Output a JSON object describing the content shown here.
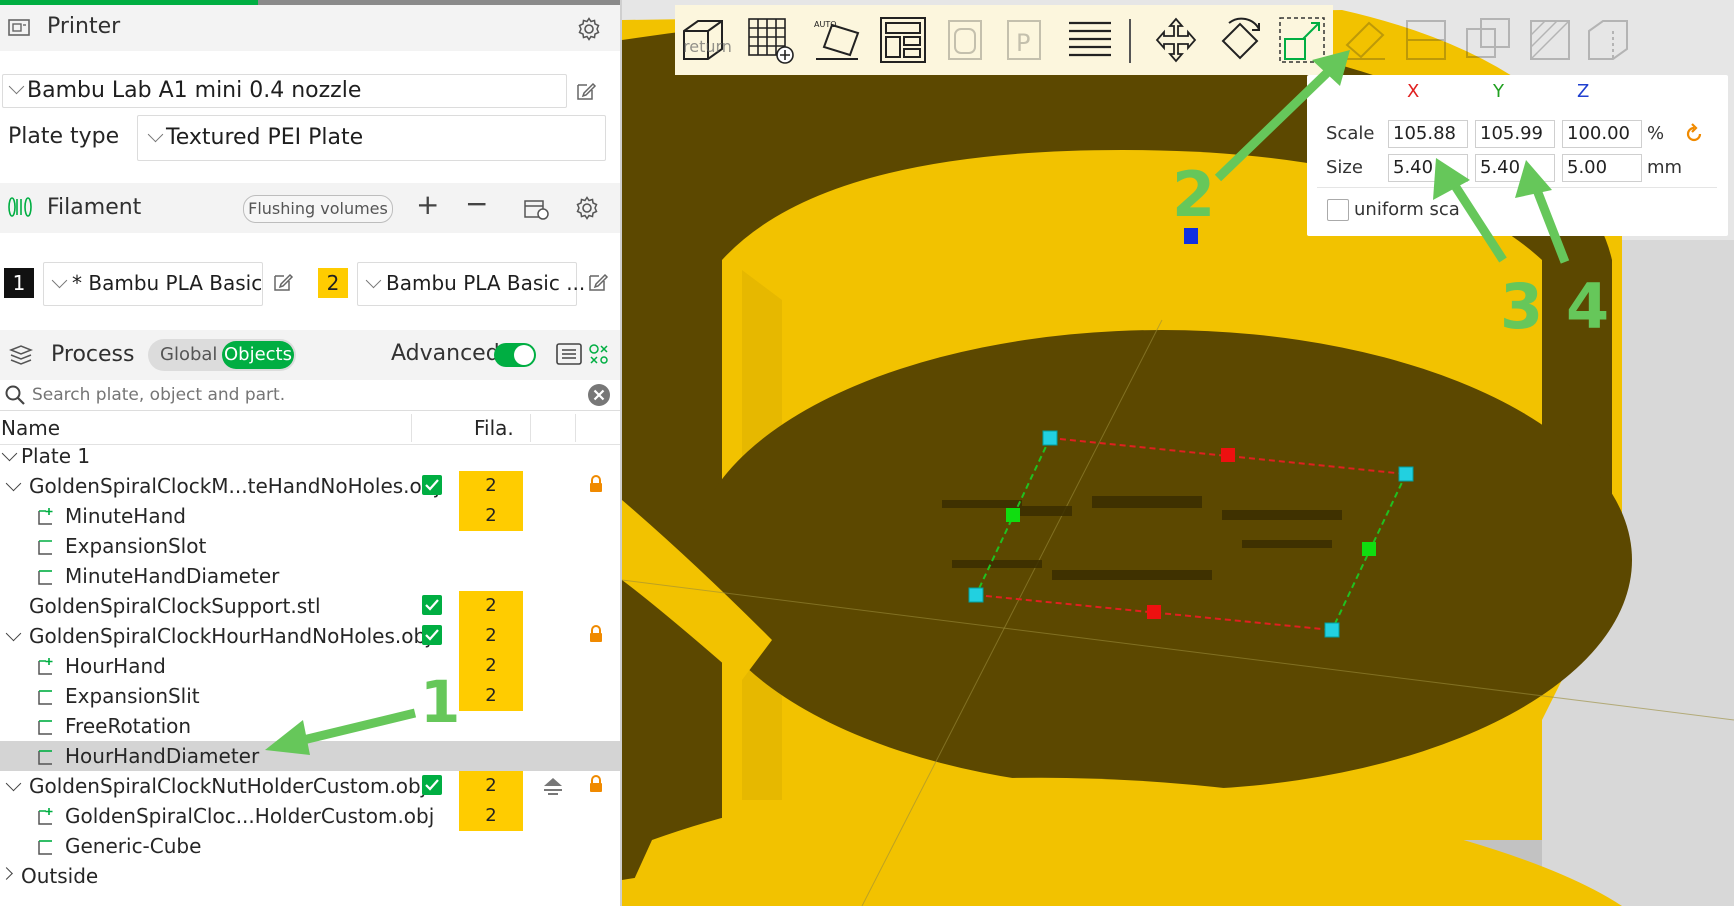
{
  "printer": {
    "title": "Printer",
    "preset": "Bambu Lab A1 mini 0.4 nozzle",
    "plate_type_label": "Plate type",
    "plate_type_value": "Textured PEI Plate"
  },
  "filament": {
    "title": "Filament",
    "flushing_label": "Flushing volumes",
    "slots": [
      {
        "index": "1",
        "name": "* Bambu PLA Basic",
        "color": "#111111"
      },
      {
        "index": "2",
        "name": "Bambu PLA Basic ...",
        "color": "#ffcc00"
      }
    ]
  },
  "process": {
    "title": "Process",
    "toggle_global": "Global",
    "toggle_objects": "Objects",
    "advanced_label": "Advanced",
    "advanced_on": true
  },
  "search": {
    "placeholder": "Search plate, object and part."
  },
  "tree": {
    "col_name": "Name",
    "col_fila": "Fila.",
    "plate": "Plate 1",
    "rows": [
      {
        "name": "GoldenSpiralClockM...teHandNoHoles.obj",
        "checked": true,
        "fila": [
          "2",
          "2"
        ],
        "lock": true
      },
      {
        "name": "MinuteHand",
        "fila": []
      },
      {
        "name": "ExpansionSlot"
      },
      {
        "name": "MinuteHandDiameter"
      },
      {
        "name": "GoldenSpiralClockSupport.stl",
        "checked": true,
        "fila": [
          "2"
        ]
      },
      {
        "name": "GoldenSpiralClockHourHandNoHoles.obj",
        "checked": true,
        "fila": [
          "2",
          "2",
          "2"
        ],
        "lock": true
      },
      {
        "name": "HourHand"
      },
      {
        "name": "ExpansionSlit"
      },
      {
        "name": "FreeRotation"
      },
      {
        "name": "HourHandDiameter",
        "selected": true
      },
      {
        "name": "GoldenSpiralClockNutHolderCustom.obj",
        "checked": true,
        "fila": [
          "2",
          "2"
        ],
        "lock": true
      },
      {
        "name": "GoldenSpiralCloc...HolderCustom.obj"
      },
      {
        "name": "Generic-Cube"
      }
    ],
    "outside": "Outside"
  },
  "scale_panel": {
    "x_label": "X",
    "y_label": "Y",
    "z_label": "Z",
    "scale_label": "Scale",
    "size_label": "Size",
    "scale_x": "105.88",
    "scale_y": "105.99",
    "scale_z": "100.00",
    "scale_unit": "%",
    "size_x": "5.40",
    "size_y": "5.40",
    "size_z": "5.00",
    "size_unit": "mm",
    "uniform_label": "uniform sca"
  },
  "toolbar": {
    "auto_label": "AUTO",
    "return_label": "return"
  },
  "annotations": [
    "1",
    "2",
    "3",
    "4"
  ],
  "colors": {
    "accent": "#00ae42",
    "yellow": "#ffcc00",
    "annotation": "#66c75a",
    "lock": "#f08a00"
  }
}
